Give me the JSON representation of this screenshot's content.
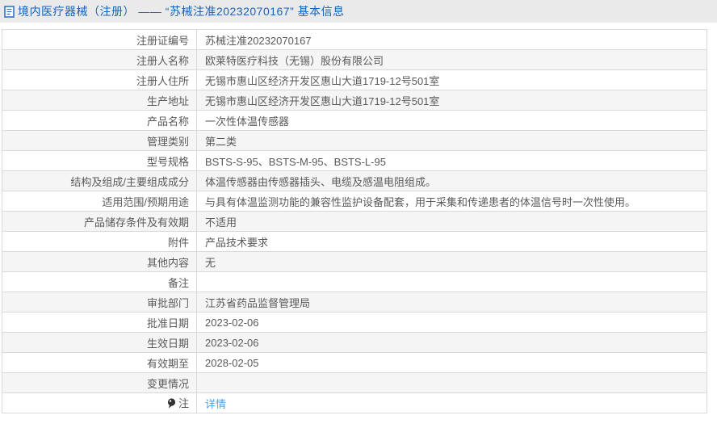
{
  "header": {
    "title": "境内医疗器械（注册） —— “苏械注准20232070167” 基本信息",
    "icon": "document-icon",
    "title_color": "#1a62b5",
    "band_color": "#eaeaea"
  },
  "table": {
    "alt_row_color": "#f5f5f5",
    "border_color": "#d9d9d9",
    "text_color": "#595959",
    "link_color": "#4d9fe0",
    "rows": [
      {
        "label": "注册证编号",
        "value": "苏械注准20232070167"
      },
      {
        "label": "注册人名称",
        "value": "欧莱特医疗科技（无锡）股份有限公司"
      },
      {
        "label": "注册人住所",
        "value": "无锡市惠山区经济开发区惠山大道1719-12号501室"
      },
      {
        "label": "生产地址",
        "value": "无锡市惠山区经济开发区惠山大道1719-12号501室"
      },
      {
        "label": "产品名称",
        "value": "一次性体温传感器"
      },
      {
        "label": "管理类别",
        "value": "第二类"
      },
      {
        "label": "型号规格",
        "value": "BSTS-S-95、BSTS-M-95、BSTS-L-95"
      },
      {
        "label": "结构及组成/主要组成成分",
        "value": "体温传感器由传感器插头、电缆及感温电阻组成。"
      },
      {
        "label": "适用范围/预期用途",
        "value": "与具有体温监测功能的兼容性监护设备配套，用于采集和传递患者的体温信号时一次性使用。"
      },
      {
        "label": "产品储存条件及有效期",
        "value": "不适用"
      },
      {
        "label": "附件",
        "value": "产品技术要求"
      },
      {
        "label": "其他内容",
        "value": "无"
      },
      {
        "label": "备注",
        "value": ""
      },
      {
        "label": "审批部门",
        "value": "江苏省药品监督管理局"
      },
      {
        "label": "批准日期",
        "value": "2023-02-06"
      },
      {
        "label": "生效日期",
        "value": "2023-02-06"
      },
      {
        "label": "有效期至",
        "value": "2028-02-05"
      },
      {
        "label": "变更情况",
        "value": ""
      },
      {
        "label": "注",
        "value": "",
        "link_label": "详情",
        "icon": "note-balloon-icon"
      }
    ]
  }
}
